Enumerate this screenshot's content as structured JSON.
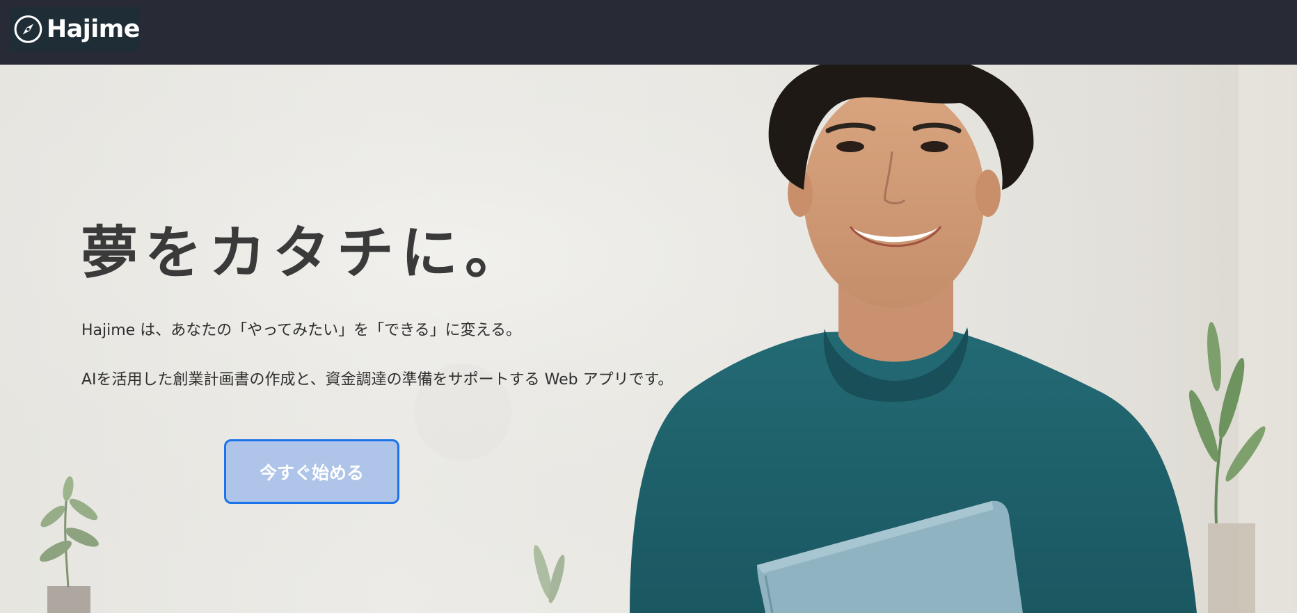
{
  "header": {
    "logo_text": "Hajime",
    "logo_icon": "compass-icon"
  },
  "hero": {
    "title": "夢をカタチに。",
    "description_1": "Hajime は、あなたの「やってみたい」を「できる」に変える。",
    "description_2": "AIを活用した創業計画書の作成と、資金調達の準備をサポートする Web アプリです。",
    "cta_label": "今すぐ始める",
    "image": "smiling-man-holding-book-photo"
  },
  "colors": {
    "header_bg": "#282a36",
    "logo_bg": "#1e2d36",
    "cta_border": "#1a73e8",
    "cta_bg": "#aec4e8",
    "sweater": "#1f5f6a",
    "book": "#8fb3c0"
  }
}
